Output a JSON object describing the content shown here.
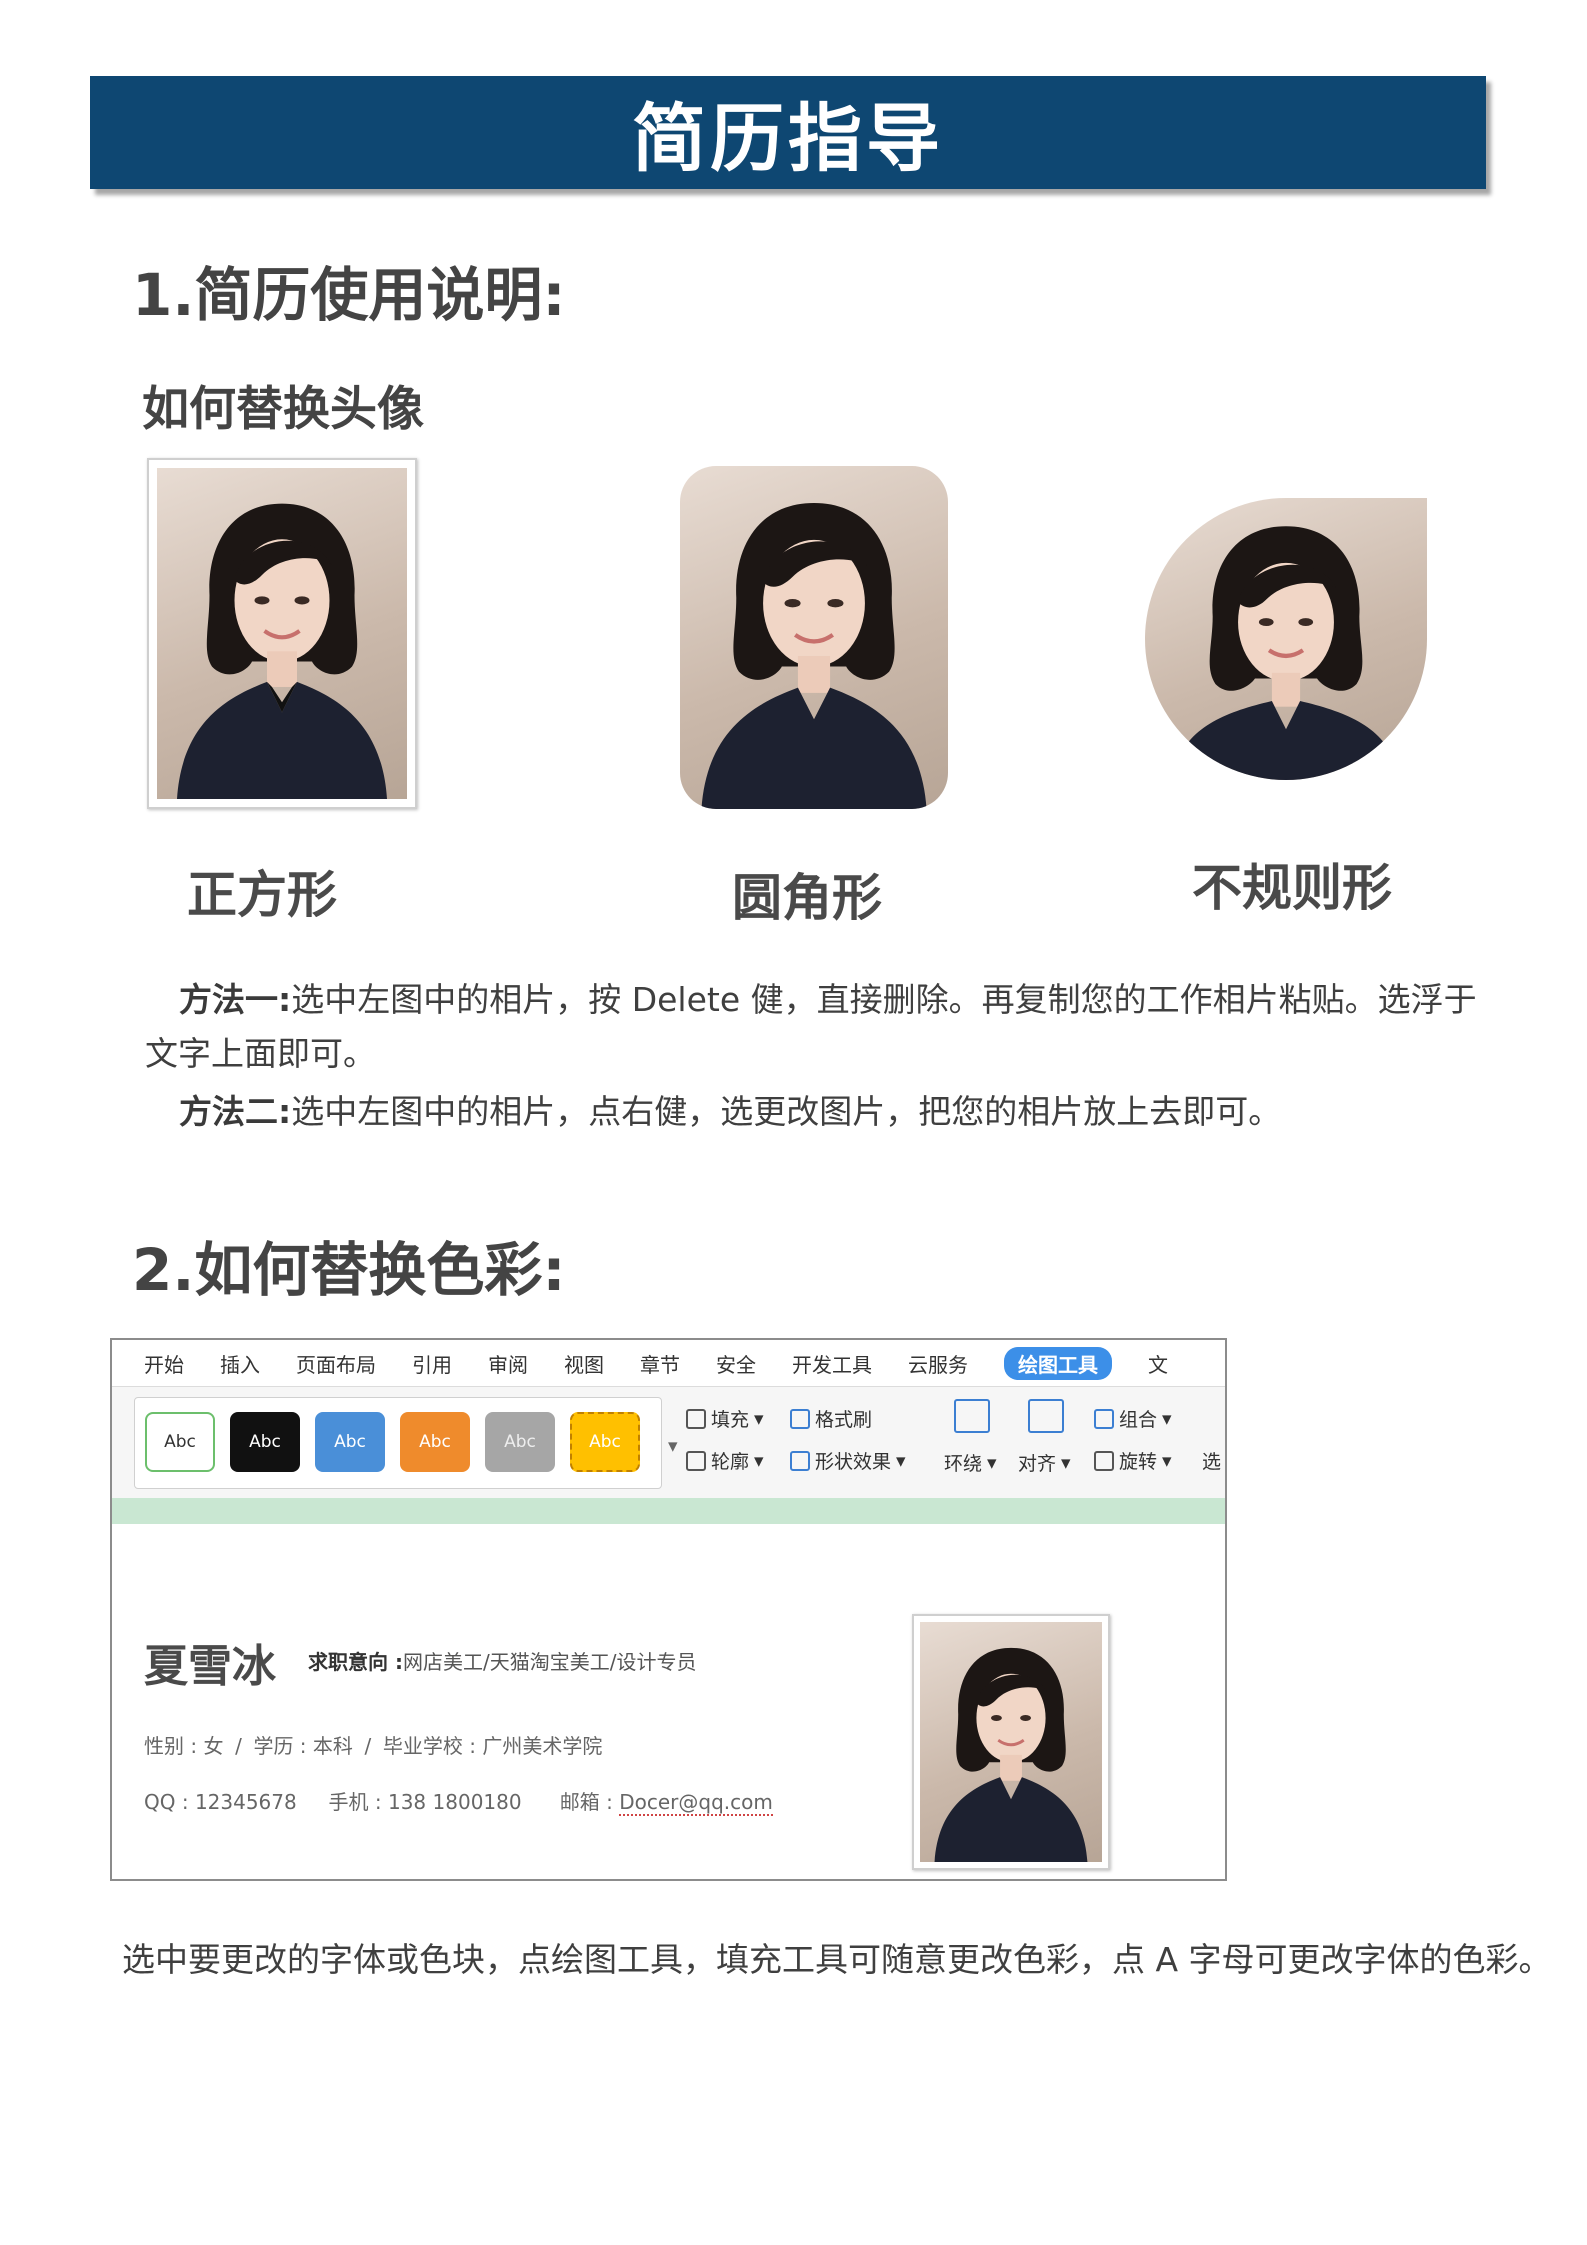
{
  "banner": {
    "title": "简历指导"
  },
  "section1": {
    "heading": "1.简历使用说明:",
    "subheading": "如何替换头像",
    "shapes": [
      {
        "label": "正方形"
      },
      {
        "label": "圆角形"
      },
      {
        "label": "不规则形"
      }
    ],
    "method1_label": "方法一:",
    "method1_text": "选中左图中的相片，按 Delete 健，直接删除。再复制您的工作相片粘贴。选浮于文字上面即可。",
    "method2_label": "方法二:",
    "method2_text": "选中左图中的相片，点右健，选更改图片，把您的相片放上去即可。"
  },
  "section2": {
    "heading": "2.如何替换色彩:",
    "menu": [
      "开始",
      "插入",
      "页面布局",
      "引用",
      "审阅",
      "视图",
      "章节",
      "安全",
      "开发工具",
      "云服务",
      "绘图工具",
      "文"
    ],
    "swatch_label": "Abc",
    "swatch_colors": {
      "white": "#ffffff",
      "black": "#111111",
      "blue": "#4a8fd8",
      "orange": "#ef8b2c",
      "gray": "#a6a6a6",
      "yellow": "#ffc000",
      "accent": "#3c8fe8",
      "green_bar": "#c9e7d2"
    },
    "ribbon": {
      "fill": "填充",
      "format_painter": "格式刷",
      "outline": "轮廓",
      "shape_effects": "形状效果",
      "wrap": "环绕",
      "align": "对齐",
      "group": "组合",
      "rotate": "旋转",
      "select": "选"
    },
    "resume": {
      "name": "夏雪冰",
      "intent_label": "求职意向 :",
      "intent_value": "网店美工/天猫淘宝美工/设计专员",
      "gender": "性别 : 女",
      "education": "学历 : 本科",
      "school": "毕业学校 : 广州美术学院",
      "qq": "QQ : 12345678",
      "phone": "手机 : 138 1800180",
      "email_label": "邮箱 :",
      "email_value": "Docer@qq.com"
    },
    "caption": "选中要更改的字体或色块，点绘图工具，填充工具可随意更改色彩，点 A 字母可更改字体的色彩。"
  }
}
